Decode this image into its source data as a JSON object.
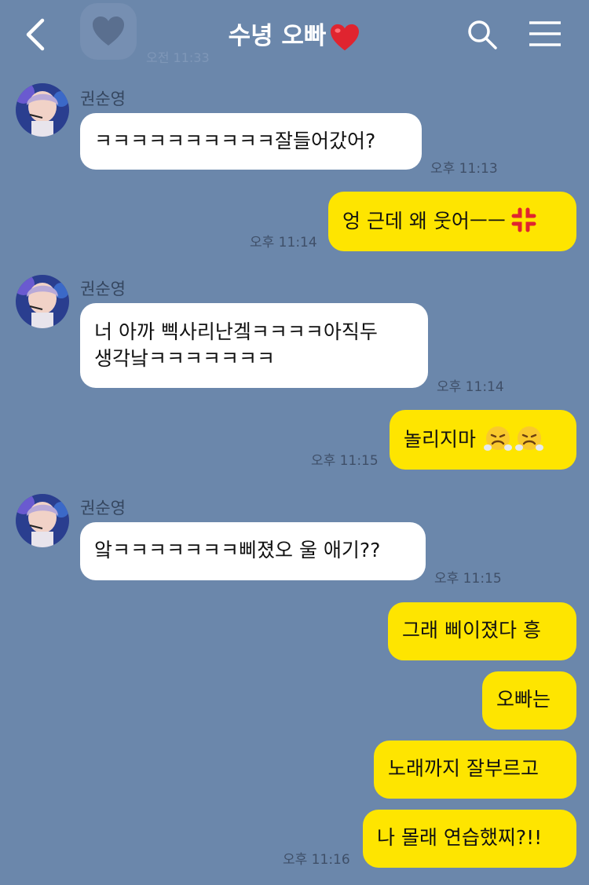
{
  "header": {
    "title": "수녕 오빠",
    "title_emoji": "red-heart",
    "prev_time": "오전 11:33",
    "icons": [
      "back-icon",
      "search-icon",
      "menu-icon"
    ]
  },
  "colors": {
    "background": "#6b87ab",
    "incoming_bubble": "#ffffff",
    "outgoing_bubble": "#fee500"
  },
  "messages": [
    {
      "sender": "권순영",
      "text": "ㅋㅋㅋㅋㅋㅋㅋㅋㅋㅋ잘들어갔어?",
      "time": "오후 11:13"
    },
    {
      "sender": "me",
      "text": "엉 근데 왜 웃어ㅡㅡ",
      "emoji": "anger-symbol",
      "time": "오후 11:14"
    },
    {
      "sender": "권순영",
      "line1": "너 아까 삑사리난겤ㅋㅋㅋㅋ아직두",
      "line2": "생각낰ㅋㅋㅋㅋㅋㅋㅋ",
      "time": "오후 11:14"
    },
    {
      "sender": "me",
      "text": "놀리지마",
      "emoji": "face-with-steam-from-nose x2",
      "time": "오후 11:15"
    },
    {
      "sender": "권순영",
      "text": "앜ㅋㅋㅋㅋㅋㅋㅋ삐졌오 울 애기??",
      "time": "오후 11:15"
    },
    {
      "sender": "me",
      "text": "그래 삐이졌다 흥"
    },
    {
      "sender": "me",
      "text": "오빠는"
    },
    {
      "sender": "me",
      "text": "노래까지 잘부르고"
    },
    {
      "sender": "me",
      "text": "나 몰래 연습했찌?!!",
      "time": "오후 11:16"
    }
  ]
}
